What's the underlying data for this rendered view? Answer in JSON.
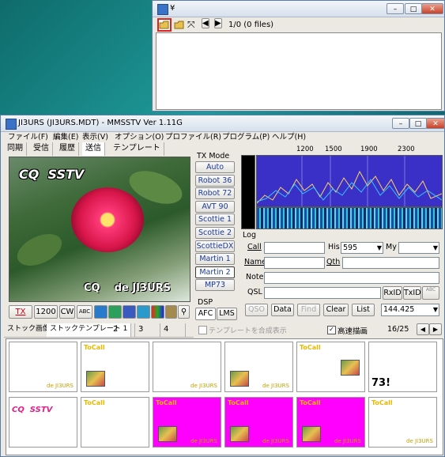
{
  "file_window": {
    "icon_label": "¥",
    "file_count": "1/0 (0 files)",
    "tools": {
      "open": "open-folder",
      "open2": "folder",
      "fit": "fit-view"
    }
  },
  "main_window": {
    "title": "JI3URS (JI3URS.MDT) - MMSSTV Ver 1.11G",
    "menu": [
      "ファイル(F)",
      "編集(E)",
      "表示(V)",
      "オプション(O)",
      "プロファイル(R)",
      "プログラム(P)",
      "ヘルプ(H)"
    ],
    "tabs": [
      "同期",
      "受信",
      "履歴",
      "送信",
      "テンプレート"
    ],
    "image_text": {
      "top": "CQ  SSTV",
      "bottom": "CQ    de JI3URS"
    },
    "bottom_bar": {
      "tx": "TX",
      "rate": "1200",
      "cw": "CW"
    },
    "tx_mode": {
      "label": "TX Mode",
      "buttons": [
        "Auto",
        "Robot 36",
        "Robot 72",
        "AVT 90",
        "Scottie 1",
        "Scottie 2",
        "ScottieDX",
        "Martin 1",
        "Martin 2",
        "MP73"
      ],
      "selected": "Martin 2"
    },
    "dsp": {
      "label": "DSP",
      "afc": "AFC",
      "lms": "LMS"
    },
    "spectrum_ticks": [
      "1200",
      "1500",
      "1900",
      "2300"
    ],
    "log": {
      "label": "Log",
      "call": "Call",
      "his": "His",
      "his_value": "595",
      "my": "My",
      "my_value": "",
      "name": "Name",
      "qth": "Qth",
      "note": "Note",
      "qsl": "QSL",
      "rxid": "RxID",
      "txid": "TxID",
      "buttons": [
        "QSO",
        "Data",
        "Find",
        "Clear",
        "List"
      ],
      "freq": "144.425"
    },
    "strip": {
      "tabs": [
        "ストック画像",
        "ストックテンプレート 1",
        "2",
        "3",
        "4"
      ],
      "merge_label": "テンプレートを合成表示",
      "fast_draw": "高速描画",
      "page": "16/25"
    },
    "thumbs": [
      {
        "bg": "#ffffff",
        "top": "",
        "bottom": "de JI3URS"
      },
      {
        "bg": "#ffffff",
        "top": "ToCall",
        "bottom": ""
      },
      {
        "bg": "#ffffff",
        "top": "",
        "bottom": "de JI3URS"
      },
      {
        "bg": "#ffffff",
        "top": "",
        "bottom": "de JI3URS"
      },
      {
        "bg": "#ffffff",
        "top": "ToCall",
        "bottom": ""
      },
      {
        "bg": "#ffffff",
        "top": "",
        "bottom": "73!"
      },
      {
        "bg": "#ffffff",
        "top": "CQ  SSTV",
        "bottom": ""
      },
      {
        "bg": "#ffffff",
        "top": "ToCall",
        "bottom": ""
      },
      {
        "bg": "#ff00ff",
        "top": "ToCall",
        "bottom": "de JI3URS"
      },
      {
        "bg": "#ff00ff",
        "top": "ToCall",
        "bottom": "de JI3URS"
      },
      {
        "bg": "#ff00ff",
        "top": "ToCall",
        "bottom": "de JI3URS"
      },
      {
        "bg": "#ffffff",
        "top": "ToCall",
        "bottom": "de JI3URS"
      }
    ]
  }
}
